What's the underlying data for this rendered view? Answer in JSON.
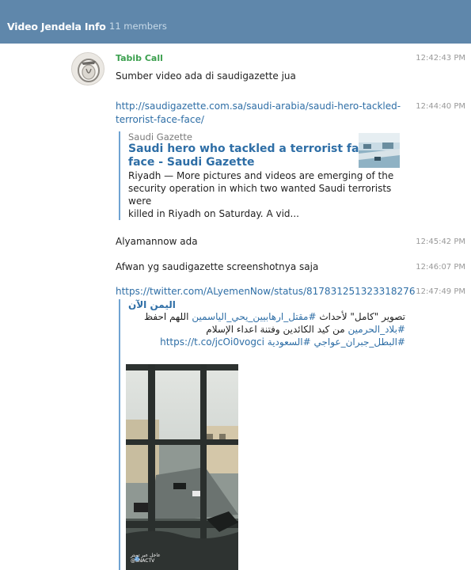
{
  "header": {
    "title": "Video Jendela Info",
    "members": "11 members"
  },
  "messages": [
    {
      "sender": "Tabib Call",
      "text": "Sumber video ada di saudigazette jua",
      "time": "12:42:43 PM"
    },
    {
      "text": "http://saudigazette.com.sa/saudi-arabia/saudi-hero-tackled-terrorist-face-face/",
      "text_line1": "http://saudigazette.com.sa/saudi-arabia/saudi-hero-tackled-",
      "text_line2": "terrorist-face-face/",
      "time": "12:44:40 PM",
      "preview": {
        "site": "Saudi Gazette",
        "title_line1": "Saudi hero who tackled a terrorist face to",
        "title_line2": "face - Saudi Gazette",
        "desc_line1": "Riyadh — More pictures and videos are emerging of the",
        "desc_line2": "security operation in which two wanted Saudi terrorists were",
        "desc_line3": "killed in Riyadh on Saturday. A vid..."
      }
    },
    {
      "text": "Alyamannow ada",
      "time": "12:45:42 PM"
    },
    {
      "text": "Afwan yg saudigazette screenshotnya saja",
      "time": "12:46:07 PM"
    },
    {
      "text": "https://twitter.com/ALyemenNow/status/817831251323318276",
      "time": "12:47:49 PM",
      "preview": {
        "name": "اليمن الآن",
        "line1_plain": "تصوير \"كامل\" لأحداث ",
        "line1_tag": "#مقتل_ارهابيين_يحي_الياسمين",
        "line1_rest": " اللهم احفظ",
        "line2_tag": "#بلاد_الحرمين",
        "line2_rest": " من كيد الكائدين وفتنة اعداء الإسلام",
        "line3_tag1": "#البطل_جبران_عواجي",
        "line3_tag2": "#السعودية",
        "line3_link": "https://t.co/jcOi0vogci",
        "video_watermark": "عاجل عبر تويتر @SNACTV"
      }
    }
  ],
  "colors": {
    "header_bg": "#5f87ab",
    "sender_name": "#3ca04f",
    "link": "#2e6ea6",
    "preview_border": "#6fa3d2",
    "timestamp": "#999999"
  }
}
